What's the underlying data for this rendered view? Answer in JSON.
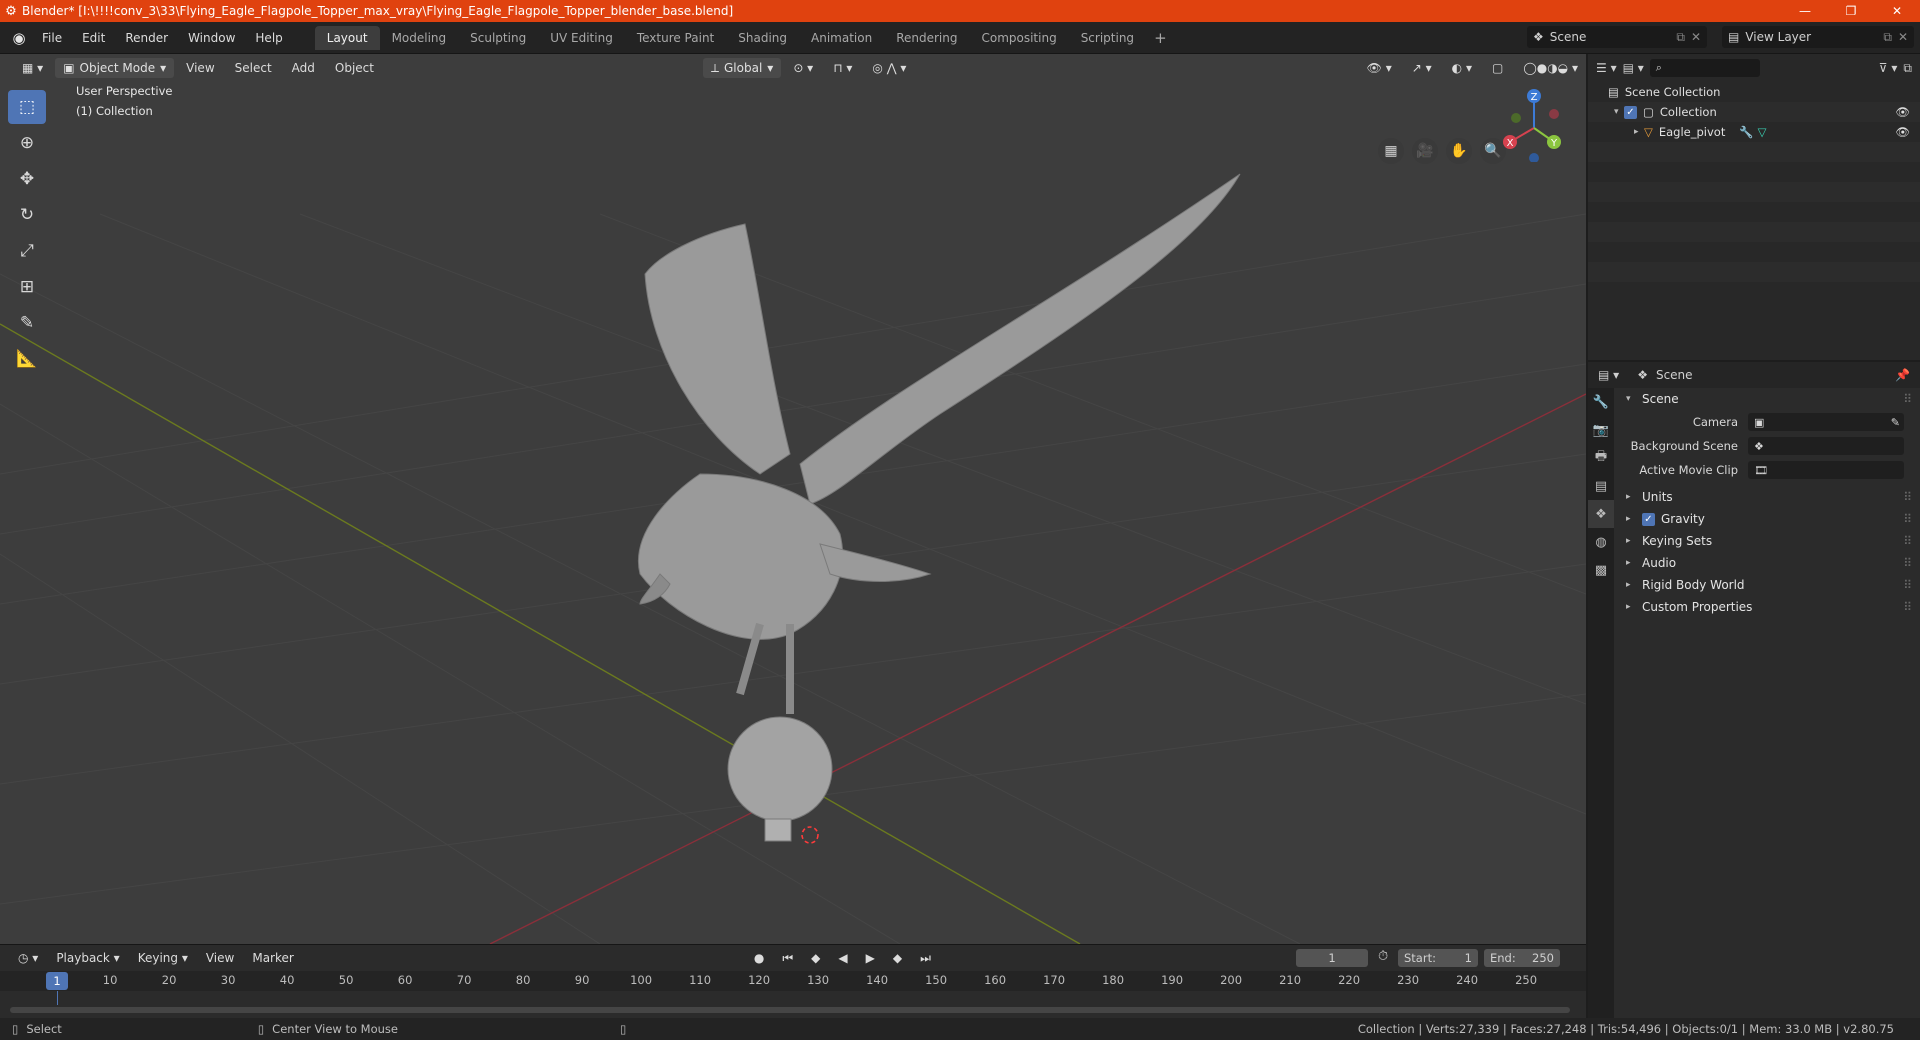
{
  "window": {
    "title": "Blender* [I:\\!!!!conv_3\\33\\Flying_Eagle_Flagpole_Topper_max_vray\\Flying_Eagle_Flagpole_Topper_blender_base.blend]",
    "min": "—",
    "max": "❐",
    "close": "✕"
  },
  "menu": [
    "File",
    "Edit",
    "Render",
    "Window",
    "Help"
  ],
  "workspace_tabs": [
    "Layout",
    "Modeling",
    "Sculpting",
    "UV Editing",
    "Texture Paint",
    "Shading",
    "Animation",
    "Rendering",
    "Compositing",
    "Scripting"
  ],
  "active_tab": "Layout",
  "scene_selector": {
    "value": "Scene"
  },
  "view_layer": {
    "value": "View Layer"
  },
  "viewport": {
    "mode": "Object Mode",
    "menus": [
      "View",
      "Select",
      "Add",
      "Object"
    ],
    "orientation": "Global",
    "overlay_title": "User Perspective",
    "overlay_collection": "(1) Collection",
    "gizmo": {
      "x": "X",
      "y": "Y",
      "z": "Z"
    }
  },
  "outliner": {
    "search_placeholder": "",
    "items": [
      {
        "label": "Scene Collection"
      },
      {
        "label": "Collection"
      },
      {
        "label": "Eagle_pivot"
      }
    ]
  },
  "properties": {
    "context": "Scene",
    "panel_title": "Scene",
    "fields": [
      {
        "label": "Camera",
        "value": ""
      },
      {
        "label": "Background Scene",
        "value": ""
      },
      {
        "label": "Active Movie Clip",
        "value": ""
      }
    ],
    "sections": [
      {
        "label": "Units",
        "checkbox": false
      },
      {
        "label": "Gravity",
        "checkbox": true
      },
      {
        "label": "Keying Sets",
        "checkbox": false
      },
      {
        "label": "Audio",
        "checkbox": false
      },
      {
        "label": "Rigid Body World",
        "checkbox": false
      },
      {
        "label": "Custom Properties",
        "checkbox": false
      }
    ]
  },
  "timeline": {
    "menus": [
      "Playback",
      "Keying",
      "View",
      "Marker"
    ],
    "current_frame": "1",
    "start_label": "Start:",
    "start": "1",
    "end_label": "End:",
    "end": "250",
    "frame_labels": [
      "10",
      "20",
      "30",
      "40",
      "50",
      "60",
      "70",
      "80",
      "90",
      "100",
      "110",
      "120",
      "130",
      "140",
      "150",
      "160",
      "170",
      "180",
      "190",
      "200",
      "210",
      "220",
      "230",
      "240",
      "250"
    ]
  },
  "status": {
    "left_action": "Select",
    "middle_action": "Center View to Mouse",
    "stats": "Collection | Verts:27,339 | Faces:27,248 | Tris:54,496 | Objects:0/1 | Mem: 33.0 MB | v2.80.75"
  }
}
